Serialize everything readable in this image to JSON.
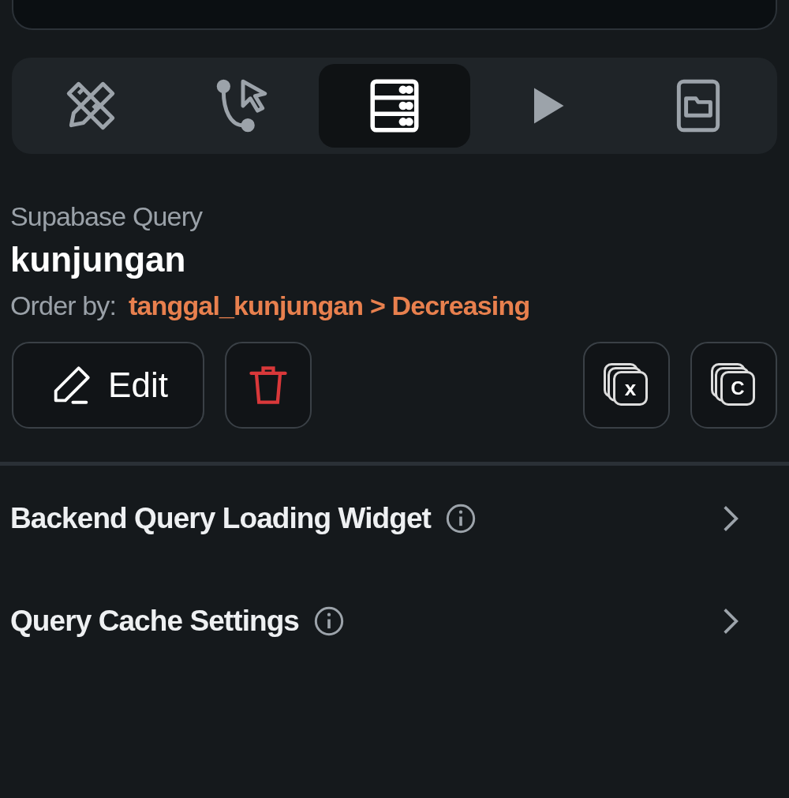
{
  "tabs": [
    {
      "kind": "design",
      "selected": false
    },
    {
      "kind": "logic",
      "selected": false
    },
    {
      "kind": "data",
      "selected": true
    },
    {
      "kind": "run",
      "selected": false
    },
    {
      "kind": "files",
      "selected": false
    }
  ],
  "query": {
    "type": "Supabase Query",
    "name": "kunjungan",
    "order_label": "Order by:",
    "order_value": "tanggal_kunjungan > Decreasing"
  },
  "actions": {
    "edit": "Edit",
    "variable_letter": "x",
    "copy_letter": "C"
  },
  "sections": [
    {
      "title": "Backend Query Loading Widget",
      "expanded": false
    },
    {
      "title": "Query Cache Settings",
      "expanded": false
    }
  ]
}
